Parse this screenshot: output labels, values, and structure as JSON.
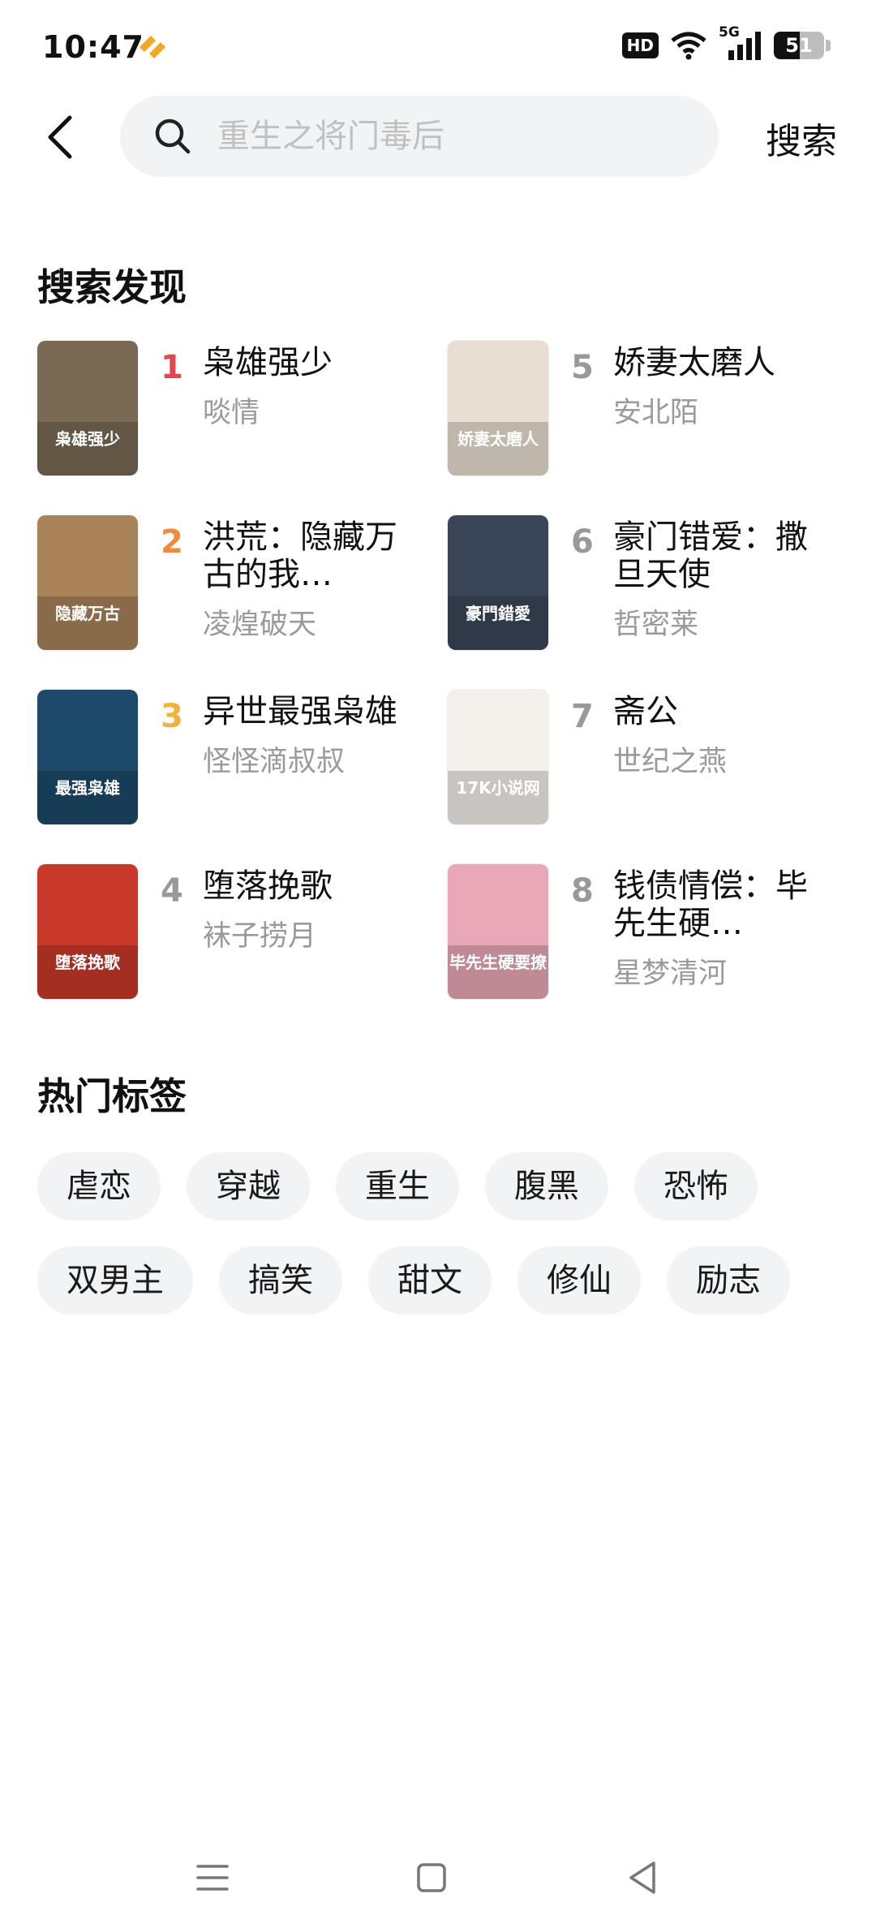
{
  "status_bar": {
    "time": "10:47",
    "hd_label": "HD",
    "network_label": "5G",
    "battery_level": "51",
    "battery_fraction": 0.51
  },
  "search": {
    "placeholder": "重生之将门毒后",
    "button_label": "搜索"
  },
  "discovery": {
    "title": "搜索发现",
    "books": [
      {
        "rank": "1",
        "title": "枭雄强少",
        "author": "啖情",
        "rank_color": "#e8434f",
        "cover_text": "枭雄强少",
        "cover_bg": "#7a6a55"
      },
      {
        "rank": "2",
        "title": "洪荒：隐藏万古的我…",
        "author": "凌煌破天",
        "rank_color": "#f08a3c",
        "cover_text": "隐藏万古",
        "cover_bg": "#a9835a"
      },
      {
        "rank": "3",
        "title": "异世最强枭雄",
        "author": "怪怪滴叔叔",
        "rank_color": "#f2b13a",
        "cover_text": "最强枭雄",
        "cover_bg": "#1d4a6a"
      },
      {
        "rank": "4",
        "title": "堕落挽歌",
        "author": "袜子捞月",
        "rank_color": "#999999",
        "cover_text": "堕落挽歌",
        "cover_bg": "#c9392a"
      },
      {
        "rank": "5",
        "title": "娇妻太磨人",
        "author": "安北陌",
        "rank_color": "#999999",
        "cover_text": "娇妻太磨人",
        "cover_bg": "#e9ded2"
      },
      {
        "rank": "6",
        "title": "豪门错爱：撒旦天使",
        "author": "哲密莱",
        "rank_color": "#999999",
        "cover_text": "豪門錯愛",
        "cover_bg": "#3a4658"
      },
      {
        "rank": "7",
        "title": "斋公",
        "author": "世纪之燕",
        "rank_color": "#999999",
        "cover_text": "17K小说网",
        "cover_bg": "#f4f1ec"
      },
      {
        "rank": "8",
        "title": "钱债情偿：毕先生硬…",
        "author": "星梦清河",
        "rank_color": "#999999",
        "cover_text": "毕先生硬要撩",
        "cover_bg": "#e9a8b8"
      }
    ]
  },
  "hot_tags": {
    "title": "热门标签",
    "rows": [
      [
        "虐恋",
        "穿越",
        "重生",
        "腹黑",
        "恐怖"
      ],
      [
        "双男主",
        "搞笑",
        "甜文",
        "修仙",
        "励志"
      ]
    ]
  },
  "nav": {
    "items": [
      "menu-icon",
      "home-icon",
      "back-icon"
    ]
  }
}
